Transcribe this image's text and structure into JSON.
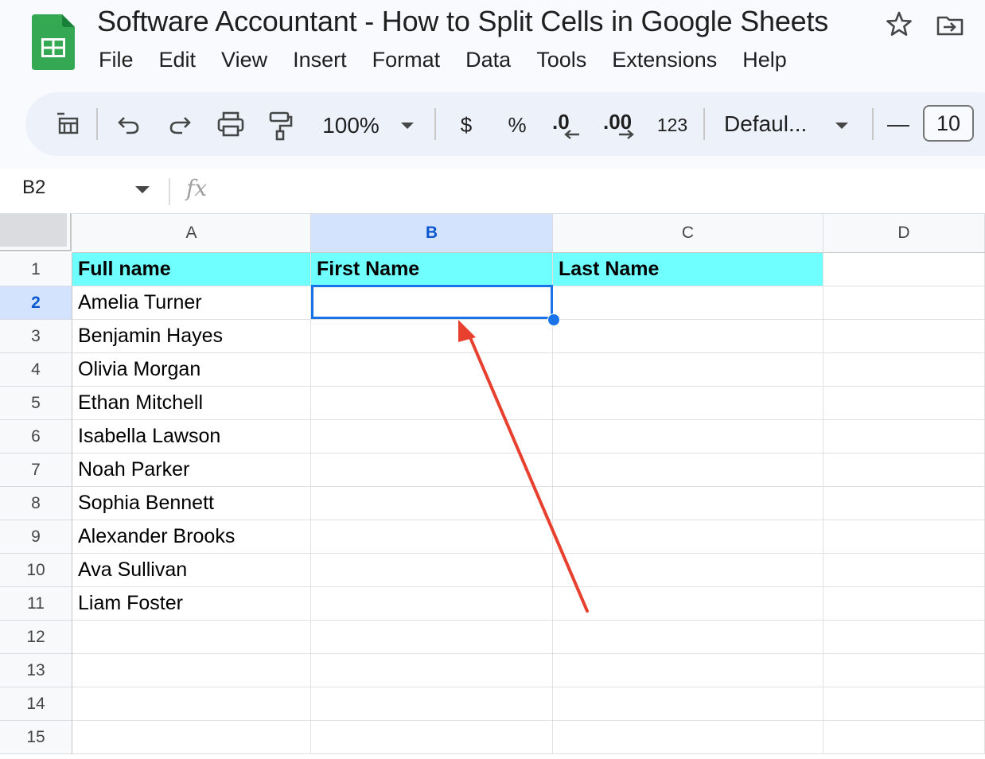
{
  "app": {
    "doc_title": "Software Accountant - How to Split Cells in Google Sheets",
    "brand_color": "#188038"
  },
  "menubar": {
    "items": [
      "File",
      "Edit",
      "View",
      "Insert",
      "Format",
      "Data",
      "Tools",
      "Extensions",
      "Help"
    ]
  },
  "toolbar": {
    "zoom": "100%",
    "currency": "$",
    "percent": "%",
    "decrease_decimal": ".0",
    "increase_decimal": ".00",
    "number_format": "123",
    "font": "Defaul...",
    "font_size_minus": "—",
    "font_size": "10"
  },
  "formula_bar": {
    "name_box": "B2",
    "fx": "fx",
    "content": ""
  },
  "sheet": {
    "columns": [
      "A",
      "B",
      "C",
      "D"
    ],
    "selected_column": "B",
    "rows": [
      "1",
      "2",
      "3",
      "4",
      "5",
      "6",
      "7",
      "8",
      "9",
      "10",
      "11",
      "12",
      "13",
      "14",
      "15"
    ],
    "selected_row": "2",
    "header_fill": "#70ffff",
    "selection_color": "#1a73e8",
    "cells": {
      "A": [
        "Full name",
        "Amelia Turner",
        "Benjamin Hayes",
        "Olivia Morgan",
        "Ethan Mitchell",
        "Isabella Lawson",
        "Noah Parker",
        "Sophia Bennett",
        "Alexander Brooks",
        "Ava Sullivan",
        "Liam Foster",
        "",
        "",
        "",
        ""
      ],
      "B": [
        "First Name",
        "",
        "",
        "",
        "",
        "",
        "",
        "",
        "",
        "",
        "",
        "",
        "",
        "",
        ""
      ],
      "C": [
        "Last Name",
        "",
        "",
        "",
        "",
        "",
        "",
        "",
        "",
        "",
        "",
        "",
        "",
        "",
        ""
      ],
      "D": [
        "",
        "",
        "",
        "",
        "",
        "",
        "",
        "",
        "",
        "",
        "",
        "",
        "",
        "",
        ""
      ]
    }
  },
  "annotation": {
    "arrow_color": "#e8402f"
  }
}
